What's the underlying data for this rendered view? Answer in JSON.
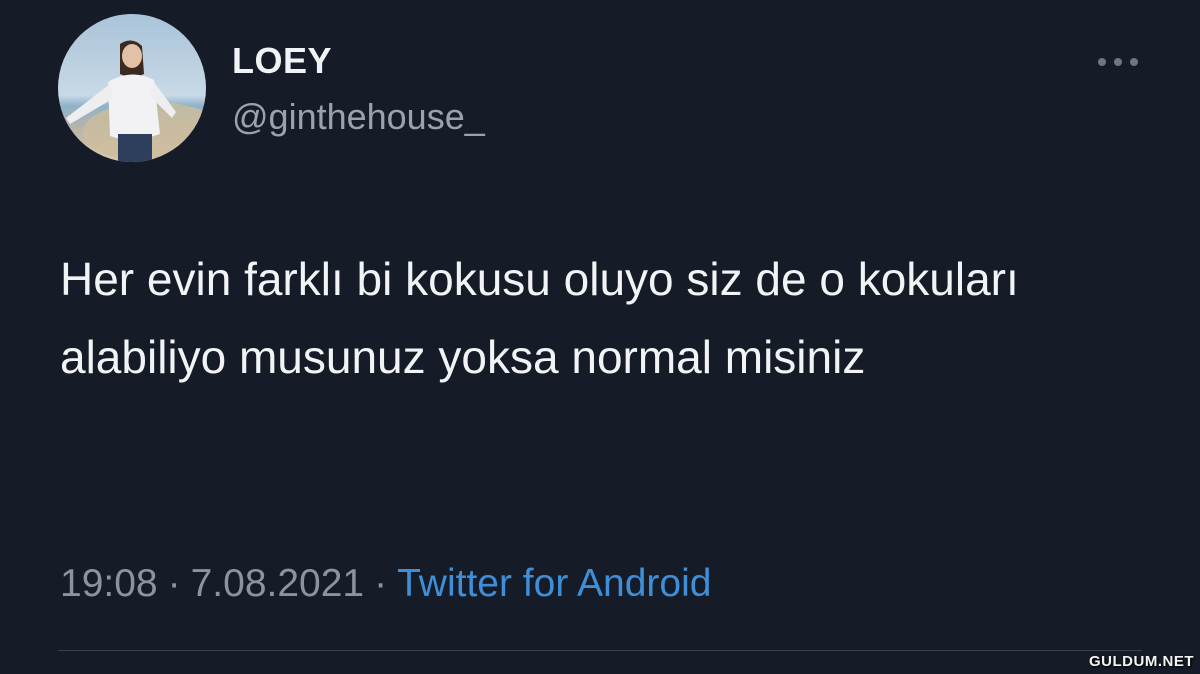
{
  "tweet": {
    "display_name": "LOEY",
    "handle": "@ginthehouse_",
    "text": "Her evin farklı bi kokusu oluyo siz de o kokuları alabiliyo musunuz yoksa normal misiniz",
    "time": "19:08",
    "date": "7.08.2021",
    "separator": "·",
    "source": "Twitter for Android",
    "more_icon": "more-horizontal-icon"
  },
  "watermark": "GULDUM.NET",
  "colors": {
    "background": "#151b27",
    "text": "#f1f3f5",
    "secondary_text": "#8b949e",
    "link": "#3f8ed8",
    "divider": "#39414d"
  }
}
